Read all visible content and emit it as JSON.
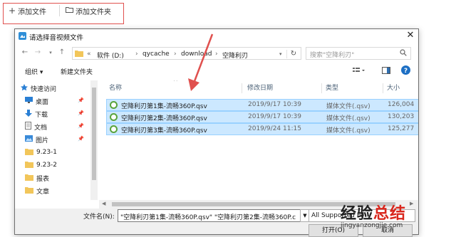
{
  "toolbar": {
    "add_file": "添加文件",
    "add_folder": "添加文件夹"
  },
  "dialog": {
    "title": "请选择音视频文件",
    "breadcrumb": [
      "«",
      "软件 (D:)",
      "qycache",
      "download",
      "空降利刃"
    ],
    "search_placeholder": "搜索\"空降利刃\"",
    "organize": "组织 ▾",
    "new_folder": "新建文件夹"
  },
  "nav": {
    "items": [
      {
        "label": "快速访问",
        "icon": "star-icon",
        "pinned": false
      },
      {
        "label": "桌面",
        "icon": "desktop-icon",
        "pinned": true
      },
      {
        "label": "下载",
        "icon": "download-icon",
        "pinned": true
      },
      {
        "label": "文档",
        "icon": "document-icon",
        "pinned": true
      },
      {
        "label": "图片",
        "icon": "picture-icon",
        "pinned": true
      },
      {
        "label": "9.23-1",
        "icon": "folder-icon",
        "pinned": false
      },
      {
        "label": "9.23-2",
        "icon": "folder-icon",
        "pinned": false
      },
      {
        "label": "报表",
        "icon": "folder-icon",
        "pinned": false
      },
      {
        "label": "文章",
        "icon": "folder-icon",
        "pinned": false
      }
    ]
  },
  "columns": {
    "name": "名称",
    "modified": "修改日期",
    "type": "类型",
    "size": "大小"
  },
  "files": [
    {
      "name": "空降利刃第1集-流畅360P.qsv",
      "modified": "2019/9/17 10:39",
      "type": "媒体文件(.qsv)",
      "size": "126,004"
    },
    {
      "name": "空降利刃第2集-流畅360P.qsv",
      "modified": "2019/9/17 10:39",
      "type": "媒体文件(.qsv)",
      "size": "130,203"
    },
    {
      "name": "空降利刃第3集-流畅360P.qsv",
      "modified": "2019/9/24 11:15",
      "type": "媒体文件(.qsv)",
      "size": "125,277"
    }
  ],
  "bottom": {
    "filename_label": "文件名(N):",
    "filename_value": "\"空降利刃第1集-流畅360P.qsv\" \"空降利刃第2集-流畅360P.c",
    "filetype_value": "All Supported Fo",
    "open_label": "打开(O)",
    "cancel_label": "取消"
  },
  "watermark": {
    "brand_black": "经验",
    "brand_red": "总结",
    "url": "jingyanzongjie.com"
  },
  "colors": {
    "selection_bg": "#cce8ff",
    "selection_border": "#99d1ff",
    "annotation_red": "#e0514f",
    "qsv_green": "#5aa43b"
  }
}
